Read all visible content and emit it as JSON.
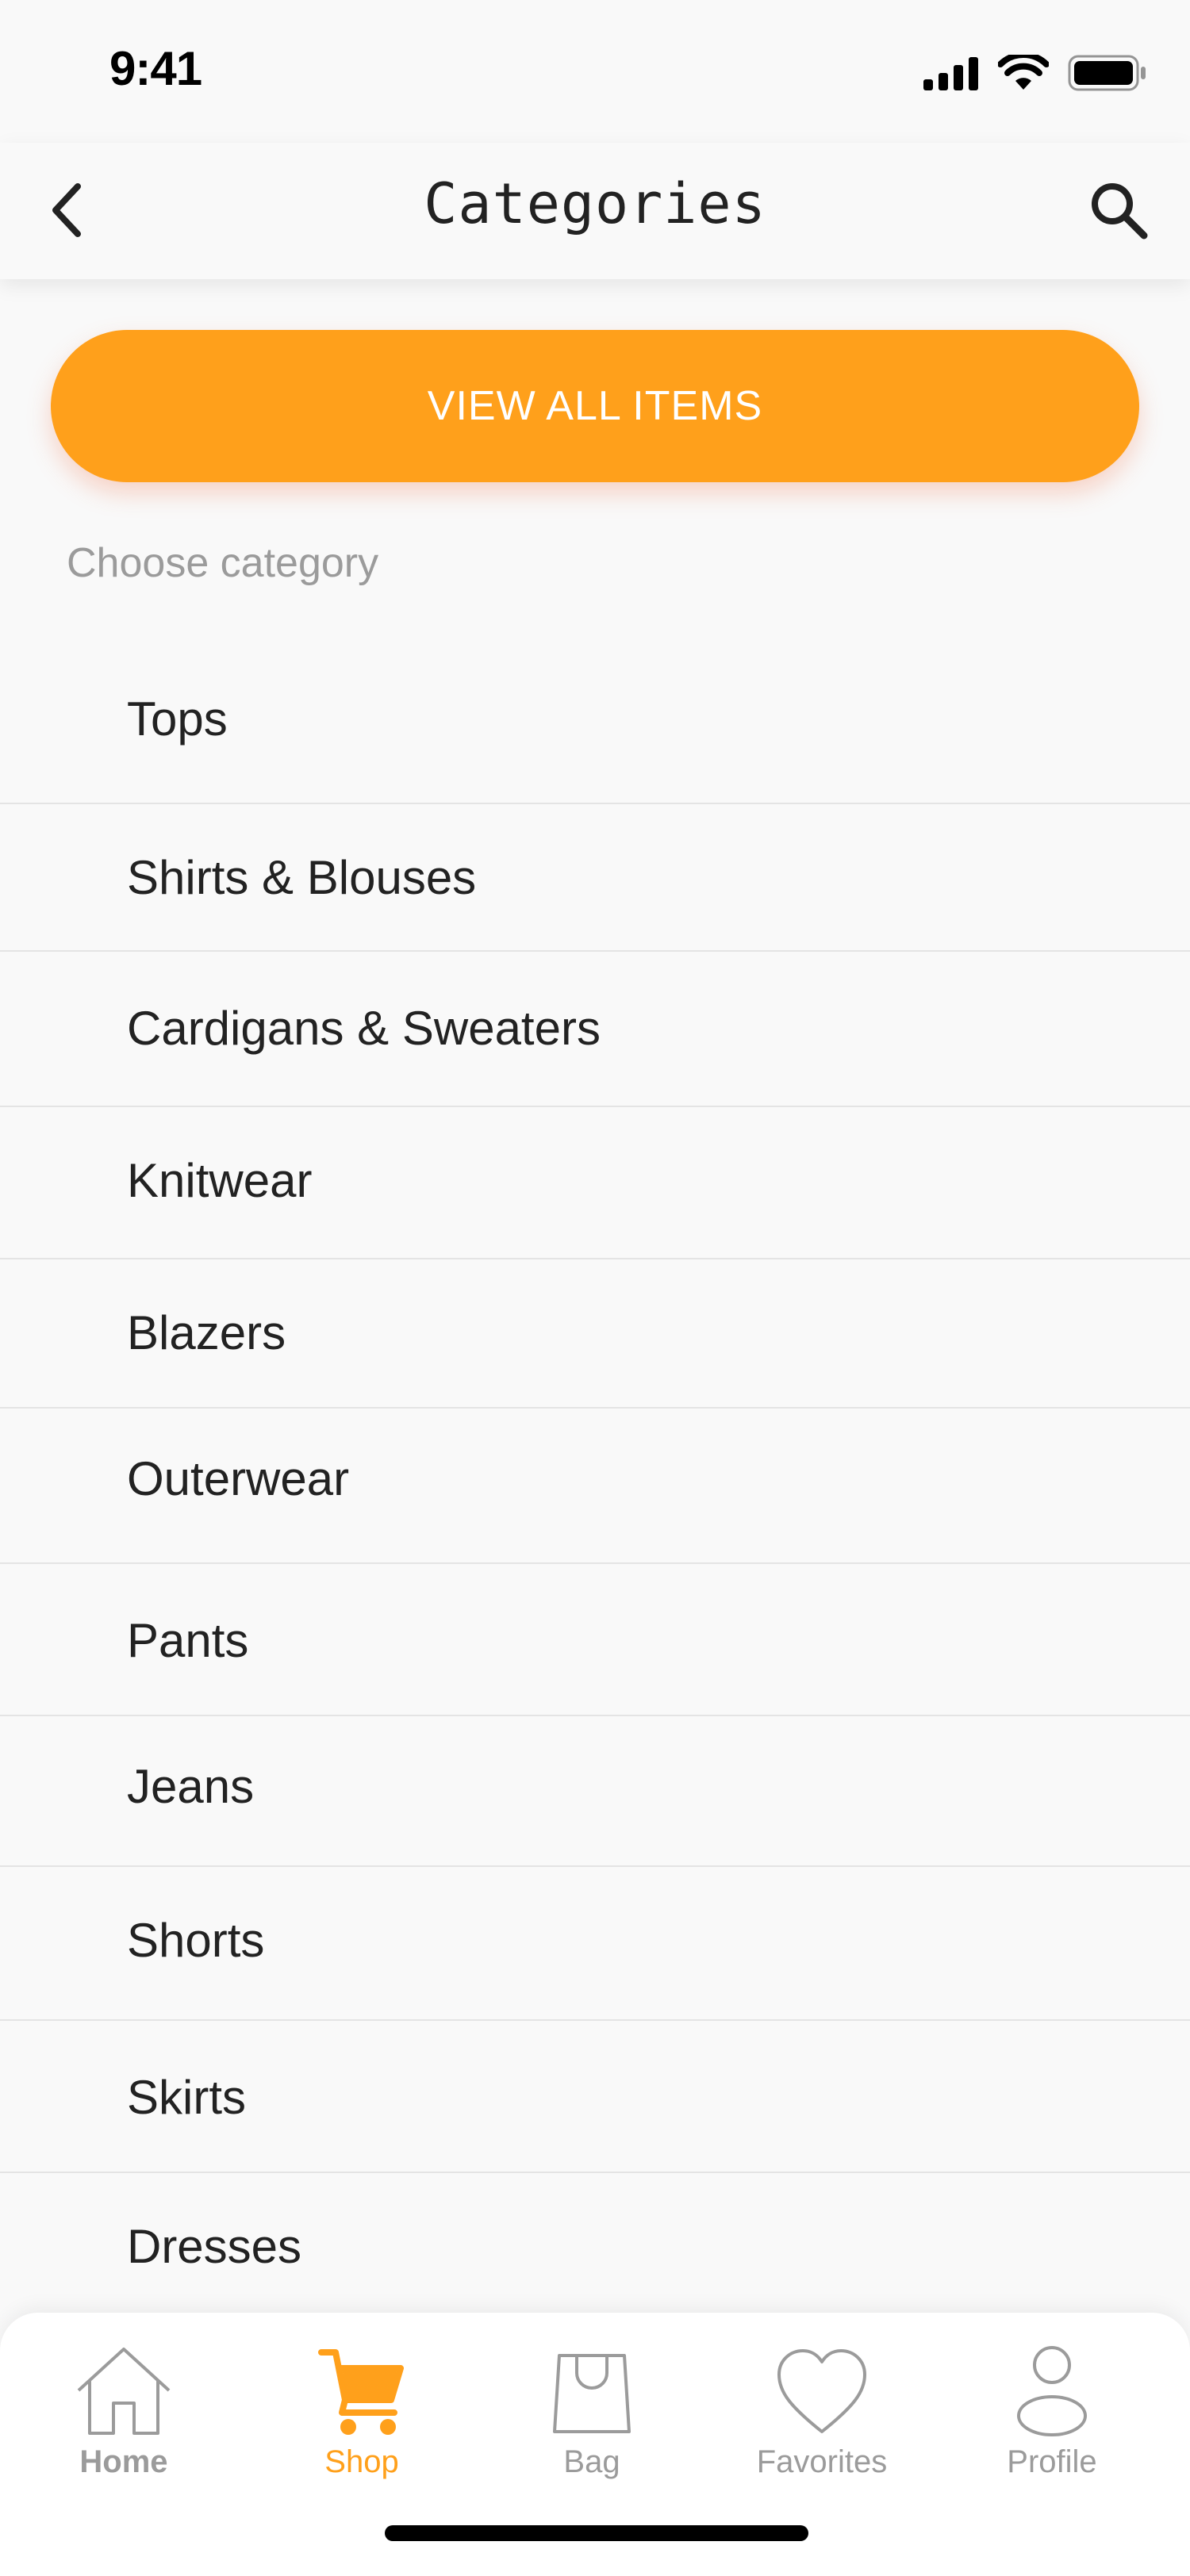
{
  "status_bar": {
    "time": "9:41"
  },
  "header": {
    "title": "Categories"
  },
  "primary_action": {
    "label": "VIEW ALL ITEMS"
  },
  "section": {
    "label": "Choose category"
  },
  "categories": [
    "Tops",
    "Shirts & Blouses",
    "Cardigans & Sweaters",
    "Knitwear",
    "Blazers",
    "Outerwear",
    "Pants",
    "Jeans",
    "Shorts",
    "Skirts",
    "Dresses"
  ],
  "nav": {
    "items": [
      {
        "label": "Home",
        "icon": "home-icon"
      },
      {
        "label": "Shop",
        "icon": "cart-icon",
        "active": true
      },
      {
        "label": "Bag",
        "icon": "bag-icon"
      },
      {
        "label": "Favorites",
        "icon": "heart-icon"
      },
      {
        "label": "Profile",
        "icon": "profile-icon"
      }
    ]
  },
  "colors": {
    "accent": "#FFA01B",
    "background": "#F9F9F9",
    "text": "#222222",
    "muted": "#9B9B9B",
    "divider": "#E4E4E4"
  }
}
